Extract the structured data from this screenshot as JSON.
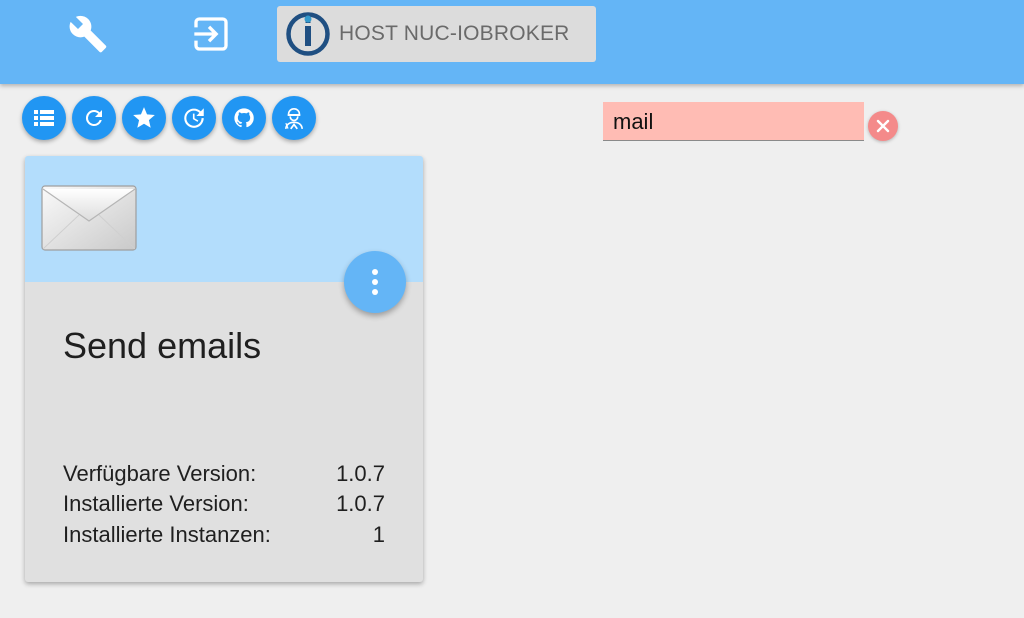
{
  "topbar": {
    "settings_icon": "wrench-icon",
    "logout_icon": "login-arrow-icon",
    "host_label": "HOST NUC-IOBROKER"
  },
  "toolbar": {
    "buttons": [
      {
        "name": "list-view-button",
        "icon": "list-icon"
      },
      {
        "name": "refresh-button",
        "icon": "refresh-icon"
      },
      {
        "name": "favorites-button",
        "icon": "star-icon"
      },
      {
        "name": "update-button",
        "icon": "update-icon"
      },
      {
        "name": "github-button",
        "icon": "github-icon"
      },
      {
        "name": "expert-button",
        "icon": "worker-icon"
      }
    ]
  },
  "search": {
    "value": "mail",
    "background": "#ffbcb4"
  },
  "adapter_card": {
    "title": "Send emails",
    "icon": "envelope-icon",
    "rows": [
      {
        "label": "Verfügbare Version:",
        "value": "1.0.7"
      },
      {
        "label": "Installierte Version:",
        "value": "1.0.7"
      },
      {
        "label": "Installierte Instanzen:",
        "value": "1"
      }
    ]
  },
  "colors": {
    "topbar": "#64b5f6",
    "accent": "#2196f3",
    "card_header": "#b3ddfc"
  }
}
